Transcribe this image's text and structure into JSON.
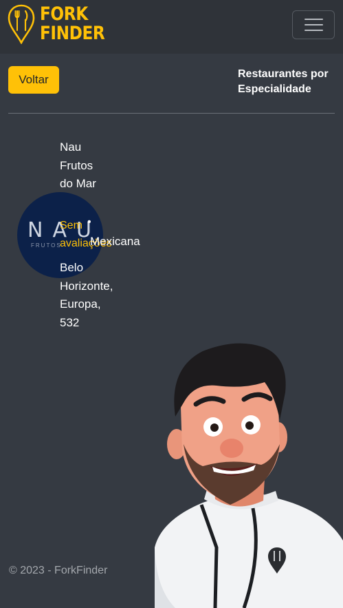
{
  "brand": {
    "line1": "FORK",
    "line2": "FINDER",
    "accent_color": "#ffc107"
  },
  "navbar": {
    "menu_icon": "hamburger-menu-icon"
  },
  "header": {
    "back_label": "Voltar",
    "title": "Restaurantes por Especialidade"
  },
  "restaurant": {
    "name": "Nau Frutos do Mar",
    "logo_text": "NAU",
    "logo_subtext": "FRUTOS",
    "rating": "Sem avaliações",
    "separator": "•",
    "cuisine": "Mexicana",
    "address": "Belo Horizonte, Europa, 532"
  },
  "footer": {
    "copyright": "© 2023 - ForkFinder"
  }
}
